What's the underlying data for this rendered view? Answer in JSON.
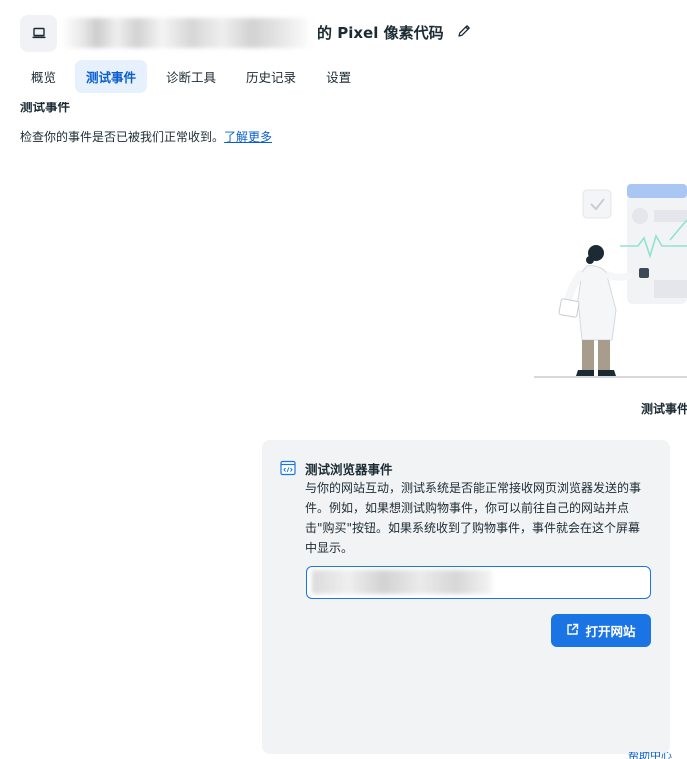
{
  "header": {
    "title": "的 Pixel 像素代码",
    "device_icon": "laptop-icon",
    "edit_icon": "pencil-icon"
  },
  "tabs": [
    {
      "label": "概览",
      "active": false
    },
    {
      "label": "测试事件",
      "active": true
    },
    {
      "label": "诊断工具",
      "active": false
    },
    {
      "label": "历史记录",
      "active": false
    },
    {
      "label": "设置",
      "active": false
    }
  ],
  "section": {
    "heading": "测试事件",
    "description": "检查你的事件是否已被我们正常收到。",
    "learn_more": "了解更多"
  },
  "illustration": {
    "caption": "测试事件"
  },
  "browser_card": {
    "title": "测试浏览器事件",
    "body": "与你的网站互动，测试系统是否能正常接收网页浏览器发送的事件。例如，如果想测试购物事件，你可以前往自己的网站并点击\"购买\"按钮。如果系统收到了购物事件，事件就会在这个屏幕中显示。",
    "input_value": "",
    "open_button": "打开网站"
  },
  "footer": {
    "link": "帮助中心"
  },
  "colors": {
    "accent": "#1b74e4",
    "tab_active_bg": "#e7f0fd",
    "card_bg": "#f2f3f5"
  }
}
